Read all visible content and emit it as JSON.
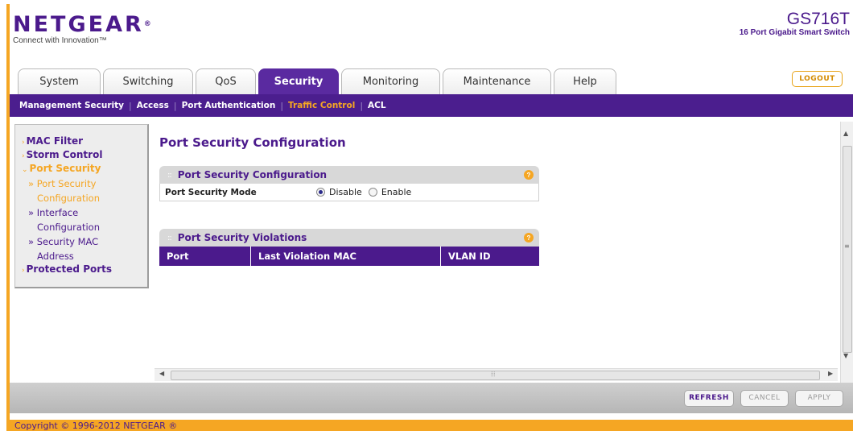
{
  "header": {
    "brand": "NETGEAR",
    "brand_mark": "®",
    "tagline": "Connect with Innovation™",
    "model_name": "GS716T",
    "model_desc": "16 Port Gigabit Smart Switch",
    "logout_label": "LOGOUT"
  },
  "tabs": [
    {
      "label": "System"
    },
    {
      "label": "Switching"
    },
    {
      "label": "QoS"
    },
    {
      "label": "Security"
    },
    {
      "label": "Monitoring"
    },
    {
      "label": "Maintenance"
    },
    {
      "label": "Help"
    }
  ],
  "active_tab": "Security",
  "subnav": {
    "items": [
      {
        "label": "Management Security"
      },
      {
        "label": "Access"
      },
      {
        "label": "Port Authentication"
      },
      {
        "label": "Traffic Control"
      },
      {
        "label": "ACL"
      }
    ],
    "active": "Traffic Control"
  },
  "leftnav": {
    "mac_filter": "MAC Filter",
    "storm_control": "Storm Control",
    "port_security": "Port Security",
    "sub_port_security_1": "Port Security",
    "sub_port_security_2": "Configuration",
    "sub_interface_1": "Interface",
    "sub_interface_2": "Configuration",
    "sub_security_mac_1": "Security MAC",
    "sub_security_mac_2": "Address",
    "protected_ports": "Protected Ports"
  },
  "main": {
    "page_title": "Port Security Configuration",
    "config_box": {
      "title": "Port Security Configuration",
      "field_label": "Port Security Mode",
      "options": [
        "Disable",
        "Enable"
      ],
      "selected": "Disable"
    },
    "violations_box": {
      "title": "Port Security Violations",
      "columns": [
        "Port",
        "Last Violation MAC",
        "VLAN ID"
      ]
    }
  },
  "footer": {
    "refresh_label": "REFRESH",
    "cancel_label": "CANCEL",
    "apply_label": "APPLY",
    "copyright": "Copyright © 1996-2012 NETGEAR ®"
  },
  "colors": {
    "brand_purple": "#4b1a8c",
    "accent_orange": "#f5a623"
  }
}
